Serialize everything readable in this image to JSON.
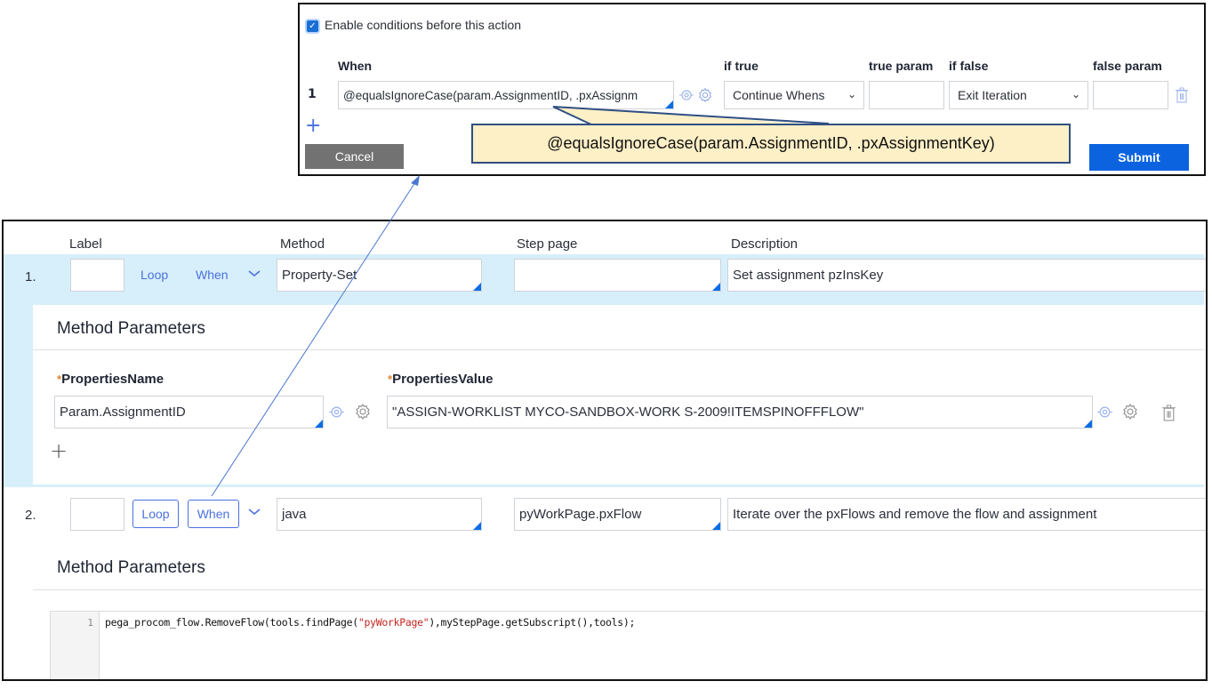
{
  "condition_popup": {
    "enable_checkbox": {
      "label": "Enable conditions before this action",
      "checked": true
    },
    "columns": {
      "when": "When",
      "if_true": "if true",
      "true_param": "true param",
      "if_false": "if false",
      "false_param": "false param"
    },
    "rows": [
      {
        "index": "1",
        "when_value": "@equalsIgnoreCase(param.AssignmentID, .pxAssignm",
        "if_true": "Continue Whens",
        "true_param": "",
        "if_false": "Exit Iteration",
        "false_param": ""
      }
    ],
    "add_icon": "+",
    "cancel_label": "Cancel",
    "submit_label": "Submit",
    "callout_text": "@equalsIgnoreCase(param.AssignmentID, .pxAssignmentKey)"
  },
  "steps_panel": {
    "columns": {
      "label": "Label",
      "method": "Method",
      "step_page": "Step page",
      "description": "Description"
    },
    "steps": [
      {
        "number": "1.",
        "label": "",
        "loop_label": "Loop",
        "when_label": "When",
        "method": "Property-Set",
        "step_page": "",
        "description": "Set assignment pzInsKey",
        "method_parameters": {
          "title": "Method Parameters",
          "properties_name_label": "PropertiesName",
          "properties_value_label": "PropertiesValue",
          "required_marker": "*",
          "rows": [
            {
              "name": "Param.AssignmentID",
              "value": "\"ASSIGN-WORKLIST MYCO-SANDBOX-WORK S-2009!ITEMSPINOFFFLOW\""
            }
          ],
          "add_icon": "+"
        }
      },
      {
        "number": "2.",
        "label": "",
        "loop_label": "Loop",
        "when_label": "When",
        "method": "java",
        "step_page": "pyWorkPage.pxFlow",
        "description": "Iterate over the pxFlows and remove the flow and assignment",
        "method_parameters": {
          "title": "Method Parameters",
          "code": {
            "line_number": "1",
            "before": "pega_procom_flow.RemoveFlow(tools.findPage(",
            "string": "\"pyWorkPage\"",
            "after": "),myStepPage.getSubscript(),tools);"
          }
        }
      }
    ]
  },
  "colors": {
    "accent_blue": "#0b63e0",
    "link_blue": "#4a70e0",
    "row_highlight": "#d7effa",
    "callout_fill": "#fdefc6",
    "required_orange": "#e0882a",
    "code_string_red": "#c4261f"
  }
}
